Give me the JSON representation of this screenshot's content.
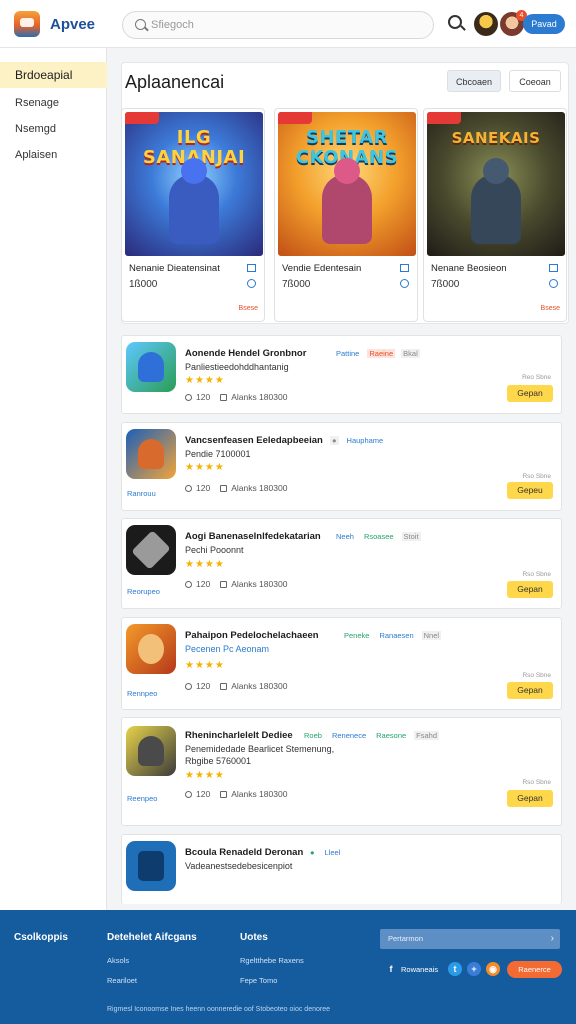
{
  "header": {
    "brand": "Apvee",
    "search_placeholder": "Sfiegoch",
    "notification_count": "4",
    "action_button": "Pavad"
  },
  "sidebar": {
    "items": [
      {
        "label": "Brdoeapial",
        "active": true
      },
      {
        "label": "Rsenage",
        "active": false
      },
      {
        "label": "Nsemgd",
        "active": false
      },
      {
        "label": "Aplaisen",
        "active": false
      }
    ]
  },
  "featured": {
    "title": "Aplaanencai",
    "chips": [
      "Cbcoaen",
      "Coeoan"
    ],
    "cards": [
      {
        "art_title": "ILG SANANJAI",
        "name": "Nenanie Dieatensinat",
        "price": "1ß000",
        "tag": "Bsese"
      },
      {
        "art_title": "SHETAR CKONANS",
        "name": "Vendie Edentesain",
        "price": "7ß000",
        "tag": ""
      },
      {
        "art_title": "SANEKAIS",
        "name": "Nenane Beosieon",
        "price": "7ß000",
        "tag": "Bsese"
      }
    ]
  },
  "apps": [
    {
      "title": "Aonende Hendel Gronbnor",
      "subtitle": "Panliestieedohddhantanig",
      "badges": [
        {
          "text": "Pattine",
          "style": "blue"
        },
        {
          "text": "Raeine",
          "style": "red"
        },
        {
          "text": "Bkal",
          "style": "gray"
        }
      ],
      "stars": "★★★★",
      "meta_a": "120",
      "meta_b": "Alanks 180300",
      "link": "",
      "note": "Reo Sbne",
      "button": "Gepan"
    },
    {
      "title": "Vancsenfeasen Eeledapbeeian",
      "subtitle": "Pendie 7100001",
      "badges": [
        {
          "text": "●",
          "style": "gray"
        },
        {
          "text": "Hauphame",
          "style": "blue"
        }
      ],
      "stars": "★★★★",
      "meta_a": "120",
      "meta_b": "Alanks 180300",
      "link": "Ranrouu",
      "note": "Rso Sbne",
      "button": "Gepeu"
    },
    {
      "title": "Aogi Banenaselnlfedekatarian",
      "subtitle": "Pechi Pooonnt",
      "badges": [
        {
          "text": "Neeh",
          "style": "blue"
        },
        {
          "text": "Rsoasee",
          "style": "green"
        },
        {
          "text": "Stoit",
          "style": "gray"
        }
      ],
      "stars": "★★★★",
      "meta_a": "120",
      "meta_b": "Alanks 180300",
      "link": "Reorupeo",
      "note": "Rso Sbne",
      "button": "Gepan"
    },
    {
      "title": "Pahaipon Pedelochelachaeen",
      "subtitle": "Pecenen Pc Aeonam",
      "badges": [
        {
          "text": "Peneke",
          "style": "green"
        },
        {
          "text": "Ranaesen",
          "style": "blue"
        },
        {
          "text": "Nnel",
          "style": "gray"
        }
      ],
      "stars": "★★★★",
      "meta_a": "120",
      "meta_b": "Alanks 180300",
      "link": "Rennpeo",
      "note": "Rso Sbne",
      "button": "Gepan"
    },
    {
      "title": "Rhenincharlelelt Dediee",
      "subtitle": "Penemidedade Bearlicet Stemenung,",
      "subtitle2": "Rbgibe 5760001",
      "badges": [
        {
          "text": "Roeb",
          "style": "green"
        },
        {
          "text": "Renenece",
          "style": "blue"
        },
        {
          "text": "Raesone",
          "style": "green"
        },
        {
          "text": "Fsahd",
          "style": "gray"
        }
      ],
      "stars": "★★★★",
      "meta_a": "120",
      "meta_b": "Alanks 180300",
      "link": "Reenpeo",
      "note": "Rso Sbne",
      "button": "Gepan"
    },
    {
      "title": "Bcoula Renadeld Deronan",
      "subtitle": "Vadeanestsedebesicenpiot",
      "badges": [
        {
          "text": "●",
          "style": "green"
        },
        {
          "text": "Lleel",
          "style": "blue"
        }
      ],
      "stars": "",
      "meta_a": "",
      "meta_b": "",
      "link": "",
      "note": "",
      "button": ""
    }
  ],
  "footer": {
    "headings": [
      "Csolkoppis",
      "Detehelet Aifcgans",
      "Uotes"
    ],
    "links_col2": [
      "Aksols",
      "Reariloet"
    ],
    "links_col3": [
      "Rgeltthebe Raxens",
      "Fepe Tomo"
    ],
    "email_placeholder": "Pertarmon",
    "subscribe": "Raenerce",
    "follow_label": "Rowaneais",
    "copyright": "Rigmesl Iconoomse Ines heenn oonneredie oof Stobeoteo oioc denoree"
  }
}
